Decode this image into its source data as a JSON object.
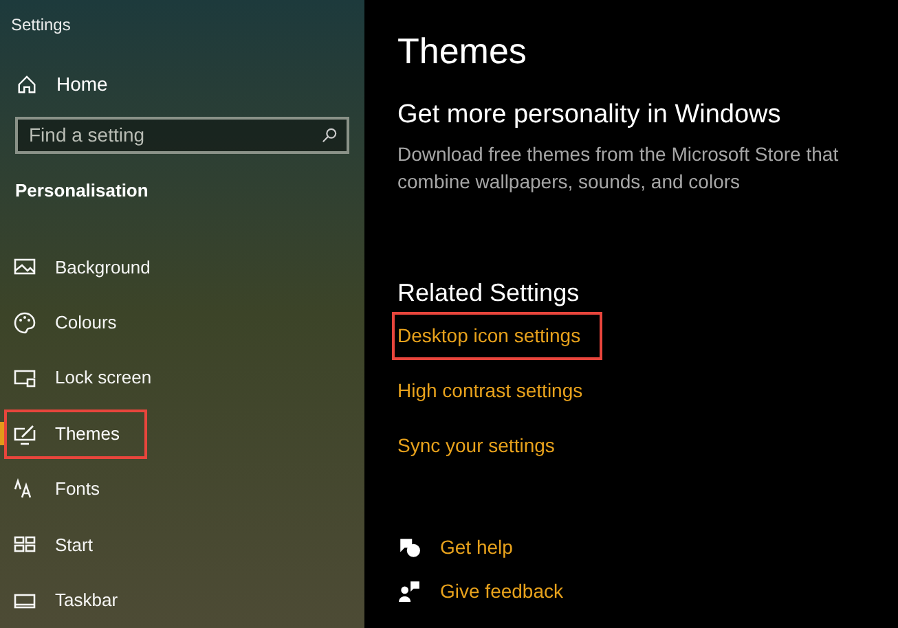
{
  "window": {
    "title": "Settings"
  },
  "sidebar": {
    "home": "Home",
    "search": {
      "placeholder": "Find a setting"
    },
    "section": "Personalisation",
    "items": [
      {
        "label": "Background",
        "kind": "background",
        "selected": false,
        "highlighted": false
      },
      {
        "label": "Colours",
        "kind": "colours",
        "selected": false,
        "highlighted": false
      },
      {
        "label": "Lock screen",
        "kind": "lock",
        "selected": false,
        "highlighted": false
      },
      {
        "label": "Themes",
        "kind": "themes",
        "selected": true,
        "highlighted": true
      },
      {
        "label": "Fonts",
        "kind": "fonts",
        "selected": false,
        "highlighted": false
      },
      {
        "label": "Start",
        "kind": "start",
        "selected": false,
        "highlighted": false
      },
      {
        "label": "Taskbar",
        "kind": "taskbar",
        "selected": false,
        "highlighted": false
      }
    ]
  },
  "main": {
    "title": "Themes",
    "promo_heading": "Get more personality in Windows",
    "promo_text": "Download free themes from the Microsoft Store that combine wallpapers, sounds, and colors",
    "related_heading": "Related Settings",
    "related_links": [
      {
        "label": "Desktop icon settings",
        "highlighted": true
      },
      {
        "label": "High contrast settings",
        "highlighted": false
      },
      {
        "label": "Sync your settings",
        "highlighted": false
      }
    ],
    "help_links": [
      {
        "label": "Get help",
        "kind": "help"
      },
      {
        "label": "Give feedback",
        "kind": "feedback"
      }
    ]
  }
}
